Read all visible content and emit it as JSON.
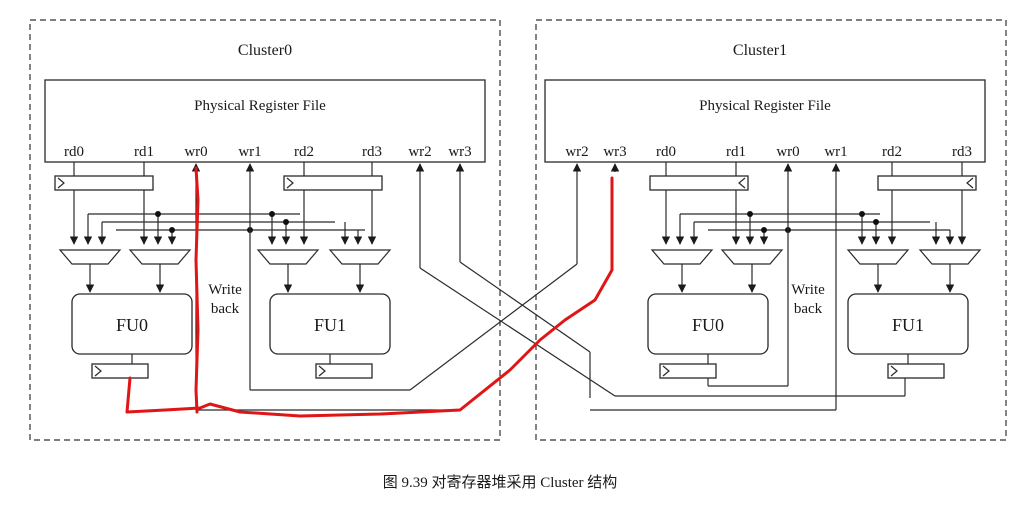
{
  "clusters": [
    {
      "title": "Cluster0",
      "register_file": "Physical Register File",
      "ports": [
        "rd0",
        "rd1",
        "wr0",
        "wr1",
        "rd2",
        "rd3",
        "wr2",
        "wr3"
      ],
      "fu": [
        "FU0",
        "FU1"
      ],
      "writeback": [
        "Write",
        "back"
      ]
    },
    {
      "title": "Cluster1",
      "register_file": "Physical Register File",
      "ports": [
        "wr2",
        "wr3",
        "rd0",
        "rd1",
        "wr0",
        "wr1",
        "rd2",
        "rd3"
      ],
      "fu": [
        "FU0",
        "FU1"
      ],
      "writeback": [
        "Write",
        "back"
      ]
    }
  ],
  "caption": "图 9.39   对寄存器堆采用 Cluster 结构",
  "colors": {
    "highlight": "#e01515",
    "line": "#2a2a2a"
  }
}
